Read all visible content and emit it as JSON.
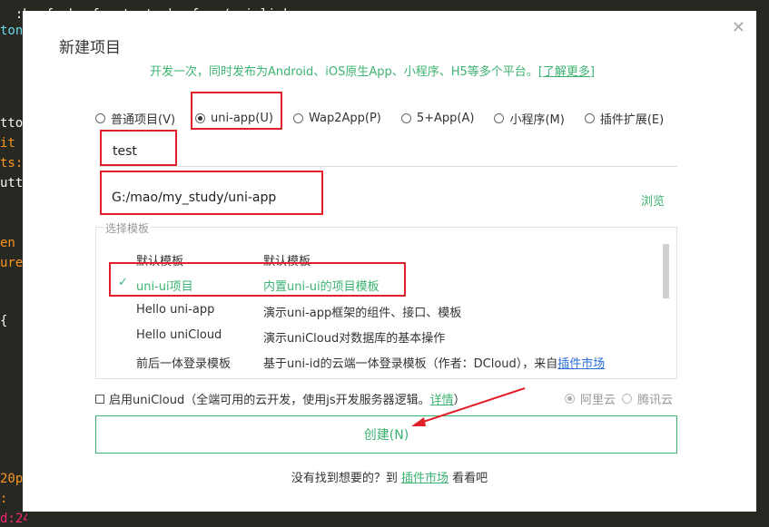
{
  "editor": {
    "top_line": ":href= href  :text= href ></uni-link>",
    "side_lines": [
      "ton",
      "",
      "",
      "",
      "",
      "tto",
      "it",
      "ts:",
      "utt",
      "",
      "",
      "en",
      "ure",
      "",
      "",
      "{",
      "",
      "",
      "",
      "",
      "",
      "",
      "20p",
      ":",
      "d:24"
    ]
  },
  "dialog": {
    "title": "新建项目",
    "close_icon": "close-icon",
    "subtitle_text": "开发一次，同时发布为Android、iOS原生App、小程序、H5等多个平台。",
    "subtitle_link": "[了解更多]"
  },
  "project_types": [
    {
      "label": "普通项目(V)",
      "selected": false
    },
    {
      "label": "uni-app(U)",
      "selected": true
    },
    {
      "label": "Wap2App(P)",
      "selected": false
    },
    {
      "label": "5+App(A)",
      "selected": false
    },
    {
      "label": "小程序(M)",
      "selected": false
    },
    {
      "label": "插件扩展(E)",
      "selected": false
    }
  ],
  "project_name": "test",
  "project_path": "G:/mao/my_study/uni-app",
  "browse_label": "浏览",
  "templates": {
    "legend": "选择模板",
    "items": [
      {
        "name": "默认模板",
        "desc": "默认模板",
        "selected": false
      },
      {
        "name": "uni-ui项目",
        "desc": "内置uni-ui的项目模板",
        "selected": true
      },
      {
        "name": "Hello uni-app",
        "desc": "演示uni-app框架的组件、接口、模板",
        "selected": false
      },
      {
        "name": "Hello uniCloud",
        "desc": "演示uniCloud对数据库的基本操作",
        "selected": false
      },
      {
        "name": "前后一体登录模板",
        "desc": "基于uni-id的云端一体登录模板（作者：DCloud），来自",
        "desc_link": "插件市场",
        "selected": false
      }
    ]
  },
  "unicloud": {
    "label": "启用uniCloud（全端可用的云开发，使用js开发服务器逻辑。",
    "link": "详情",
    "close_paren": "）",
    "checked": false,
    "providers": [
      {
        "label": "阿里云",
        "selected": true
      },
      {
        "label": "腾讯云",
        "selected": false
      }
    ]
  },
  "create_label": "创建(N)",
  "footer": {
    "prefix": "没有找到想要的？到 ",
    "link": "插件市场",
    "suffix": " 看看吧"
  },
  "colors": {
    "accent": "#3cb371",
    "highlight": "#e0202a",
    "link_blue": "#2a6fd6",
    "editor_bg": "#272822"
  }
}
